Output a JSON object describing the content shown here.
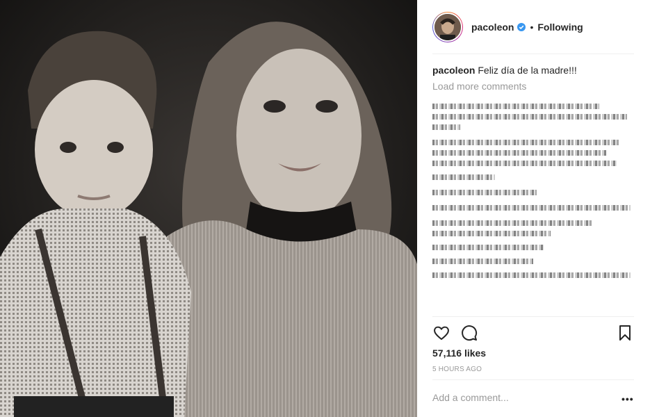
{
  "post": {
    "username": "pacoleon",
    "follow_status": "Following",
    "dot": "•",
    "caption_user": "pacoleon",
    "caption_text": "Feliz día de la madre!!!",
    "load_more": "Load more comments",
    "likes": "57,116 likes",
    "timestamp": "5 HOURS AGO",
    "add_comment_placeholder": "Add a comment...",
    "more_options": "•••"
  },
  "icons": {
    "verified": "verified-badge-icon",
    "like": "heart-icon",
    "comment": "comment-icon",
    "save": "bookmark-icon"
  },
  "colors": {
    "verified": "#3897f0",
    "text": "#262626",
    "muted": "#999999"
  }
}
